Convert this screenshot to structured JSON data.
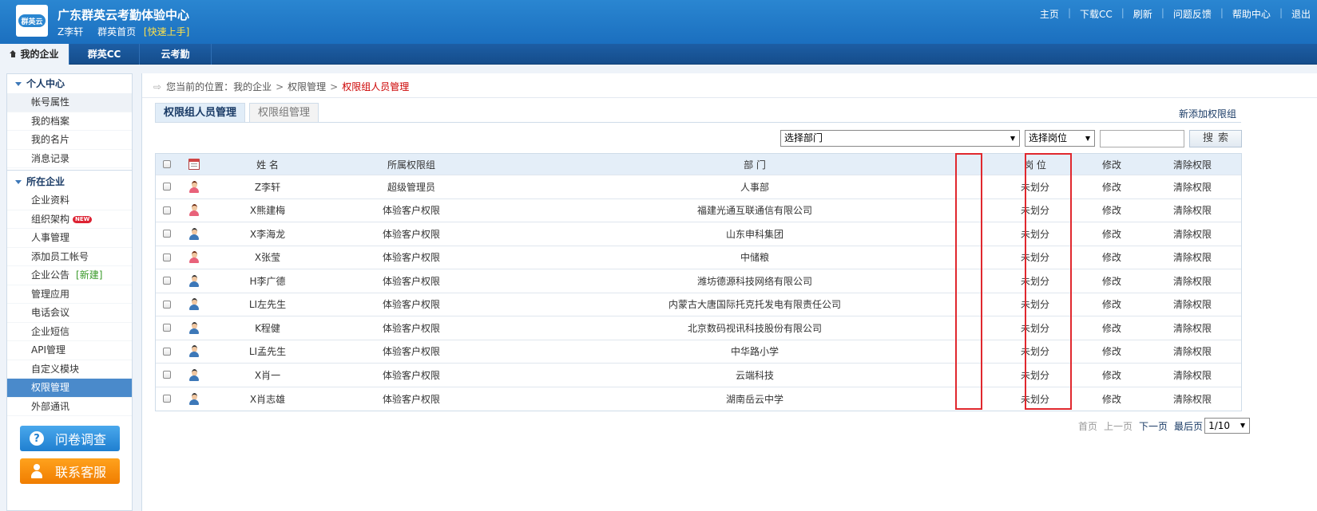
{
  "header": {
    "logo_text": "群英云",
    "title": "广东群英云考勤体验中心",
    "user": "Z李轩",
    "home": "群英首页",
    "quick_start": "[快速上手]",
    "links": [
      "主页",
      "下载CC",
      "刷新",
      "问题反馈",
      "帮助中心",
      "退出"
    ]
  },
  "nav": {
    "tabs": [
      "我的企业",
      "群英CC",
      "云考勤"
    ],
    "active": "我的企业"
  },
  "sidebar": {
    "sections": [
      {
        "title": "个人中心",
        "items": [
          "帐号属性",
          "我的档案",
          "我的名片",
          "消息记录"
        ]
      },
      {
        "title": "所在企业",
        "items": [
          "企业资料",
          "组织架构",
          "人事管理",
          "添加员工帐号",
          "企业公告",
          "管理应用",
          "电话会议",
          "企业短信",
          "API管理",
          "自定义模块",
          "权限管理",
          "外部通讯"
        ]
      }
    ],
    "badge_new": "NEW",
    "new_link": "[新建]",
    "active_item": "权限管理",
    "buttons": {
      "survey": "问卷调查",
      "service": "联系客服",
      "survey_icon": "?"
    }
  },
  "breadcrumb": {
    "prefix": "您当前的位置：",
    "items": [
      "我的企业",
      "权限管理",
      "权限组人员管理"
    ]
  },
  "tabs": [
    "权限组人员管理",
    "权限组管理"
  ],
  "add_link": "新添加权限组",
  "filters": {
    "dept": "选择部门",
    "post": "选择岗位",
    "search_btn": "搜索"
  },
  "table": {
    "headers": {
      "name": "姓 名",
      "group": "所属权限组",
      "dept": "部 门",
      "post": "岗 位",
      "edit": "修改",
      "clear": "清除权限"
    },
    "rows": [
      {
        "name": "Z李轩",
        "group": "超级管理员",
        "dept": "人事部",
        "post": "未划分",
        "edit": "修改",
        "clear": "清除权限",
        "gender": "f"
      },
      {
        "name": "X熊建梅",
        "group": "体验客户权限",
        "dept": "福建光通互联通信有限公司",
        "post": "未划分",
        "edit": "修改",
        "clear": "清除权限",
        "gender": "f"
      },
      {
        "name": "X李海龙",
        "group": "体验客户权限",
        "dept": "山东申科集团",
        "post": "未划分",
        "edit": "修改",
        "clear": "清除权限",
        "gender": "m"
      },
      {
        "name": "X张莹",
        "group": "体验客户权限",
        "dept": "中储粮",
        "post": "未划分",
        "edit": "修改",
        "clear": "清除权限",
        "gender": "f"
      },
      {
        "name": "H李广德",
        "group": "体验客户权限",
        "dept": "潍坊德源科技网络有限公司",
        "post": "未划分",
        "edit": "修改",
        "clear": "清除权限",
        "gender": "m"
      },
      {
        "name": "LI左先生",
        "group": "体验客户权限",
        "dept": "内蒙古大唐国际托克托发电有限责任公司",
        "post": "未划分",
        "edit": "修改",
        "clear": "清除权限",
        "gender": "m"
      },
      {
        "name": "K程健",
        "group": "体验客户权限",
        "dept": "北京数码视讯科技股份有限公司",
        "post": "未划分",
        "edit": "修改",
        "clear": "清除权限",
        "gender": "m"
      },
      {
        "name": "LI孟先生",
        "group": "体验客户权限",
        "dept": "中华路小学",
        "post": "未划分",
        "edit": "修改",
        "clear": "清除权限",
        "gender": "m"
      },
      {
        "name": "X肖一",
        "group": "体验客户权限",
        "dept": "云端科技",
        "post": "未划分",
        "edit": "修改",
        "clear": "清除权限",
        "gender": "m"
      },
      {
        "name": "X肖志雄",
        "group": "体验客户权限",
        "dept": "湖南岳云中学",
        "post": "未划分",
        "edit": "修改",
        "clear": "清除权限",
        "gender": "m"
      }
    ]
  },
  "pager": {
    "first": "首页",
    "prev": "上一页",
    "next": "下一页",
    "last": "最后页",
    "page": "1/10"
  },
  "colors": {
    "header": "#1b6fbf",
    "nav": "#154d8c",
    "highlight_box": "#e0282e",
    "active_side": "#4a8acb"
  }
}
